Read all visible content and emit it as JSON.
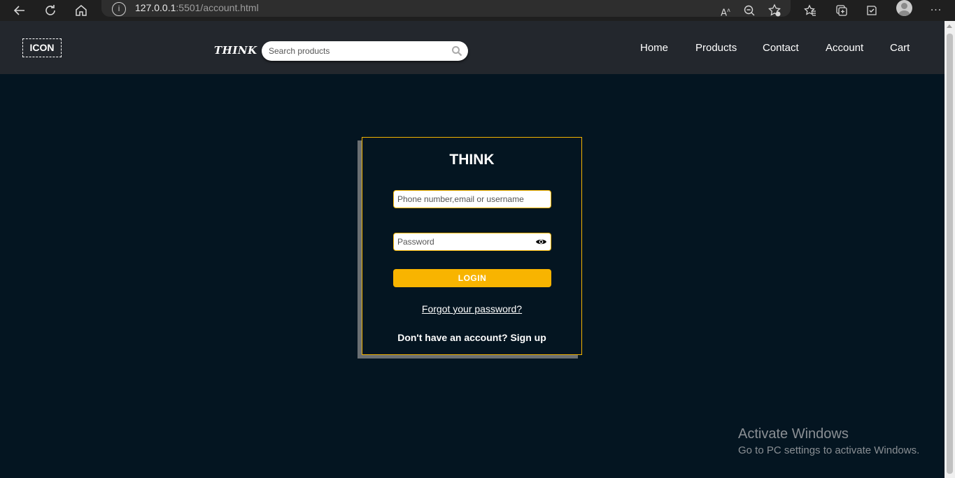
{
  "browser": {
    "url_host": "127.0.0.1",
    "url_rest": ":5501/account.html",
    "icons": [
      "back-icon",
      "reload-icon",
      "home-icon",
      "site-info-icon",
      "read-aloud-icon",
      "zoom-out-icon",
      "add-favorite-icon",
      "favorites-icon",
      "collections-icon",
      "browser-essentials-icon",
      "profile-icon",
      "more-icon"
    ]
  },
  "header": {
    "logo_text": "ICON",
    "brand": "THINK",
    "search_placeholder": "Search products",
    "nav": [
      "Home",
      "Products",
      "Contact",
      "Account",
      "Cart"
    ]
  },
  "login": {
    "title": "THINK",
    "username_placeholder": "Phone number,email or username",
    "password_placeholder": "Password",
    "login_label": "LOGIN",
    "forgot_label": "Forgot your password?",
    "signup_text": "Don't have an account? Sign up"
  },
  "watermark": {
    "line1": "Activate Windows",
    "line2": "Go to PC settings to activate Windows."
  },
  "colors": {
    "page_bg": "#041521",
    "header_bg": "#23272d",
    "accent": "#f8b400",
    "card_border": "#f3b400"
  }
}
